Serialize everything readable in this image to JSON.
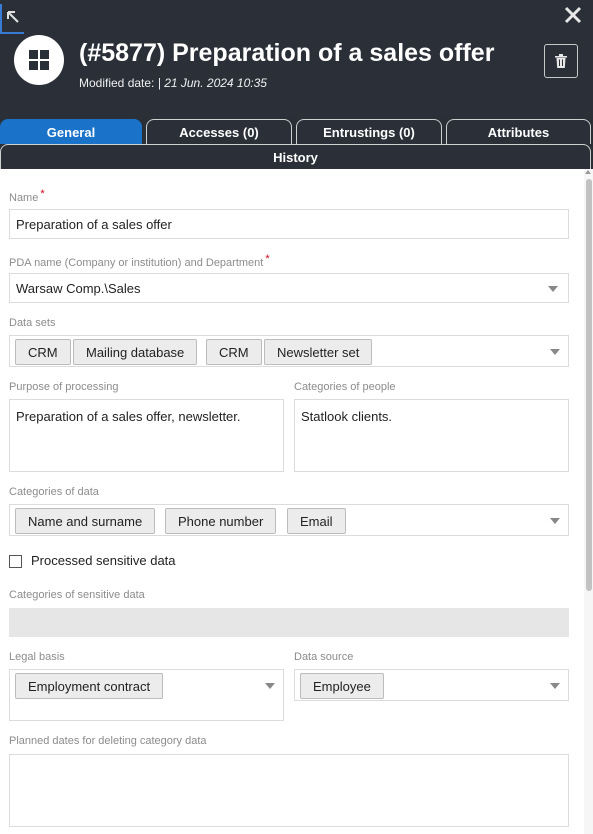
{
  "header": {
    "title": "(#5877) Preparation of a sales offer",
    "modified_label": "Modified date:",
    "modified_separator": "|",
    "modified_value": "21 Jun. 2024 10:35"
  },
  "tabs": [
    {
      "label": "General",
      "active": true
    },
    {
      "label": "Accesses (0)",
      "active": false
    },
    {
      "label": "Entrustings (0)",
      "active": false
    },
    {
      "label": "Attributes",
      "active": false
    },
    {
      "label": "History",
      "active": false
    }
  ],
  "form": {
    "name": {
      "label": "Name",
      "required": "*",
      "value": "Preparation of a sales offer"
    },
    "pda": {
      "label": "PDA name (Company or institution) and Department",
      "required": "*",
      "value": "Warsaw Comp.\\Sales"
    },
    "data_sets": {
      "label": "Data sets",
      "chips": [
        "CRM",
        "Mailing database",
        "CRM",
        "Newsletter set"
      ]
    },
    "purpose": {
      "label": "Purpose of processing",
      "value": "Preparation of a sales offer, newsletter."
    },
    "people": {
      "label": "Categories of people",
      "value": "Statlook clients."
    },
    "categories_data": {
      "label": "Categories of data",
      "chips": [
        "Name and surname",
        "Phone number",
        "Email"
      ]
    },
    "sensitive_checkbox": {
      "label": "Processed sensitive data",
      "checked": false
    },
    "sensitive_categories": {
      "label": "Categories of sensitive data",
      "value": ""
    },
    "legal_basis": {
      "label": "Legal basis",
      "chips": [
        "Employment contract"
      ]
    },
    "data_source": {
      "label": "Data source",
      "chips": [
        "Employee"
      ]
    },
    "planned_dates": {
      "label": "Planned dates for deleting category data",
      "value": ""
    }
  },
  "colors": {
    "header_bg": "#2b3038",
    "active_tab": "#1a73c8",
    "required": "#d0021b",
    "disabled_field": "#e6e6e6"
  },
  "icons": [
    "undock-icon",
    "close-icon",
    "grid-icon",
    "trash-icon",
    "chevron-down-icon"
  ]
}
